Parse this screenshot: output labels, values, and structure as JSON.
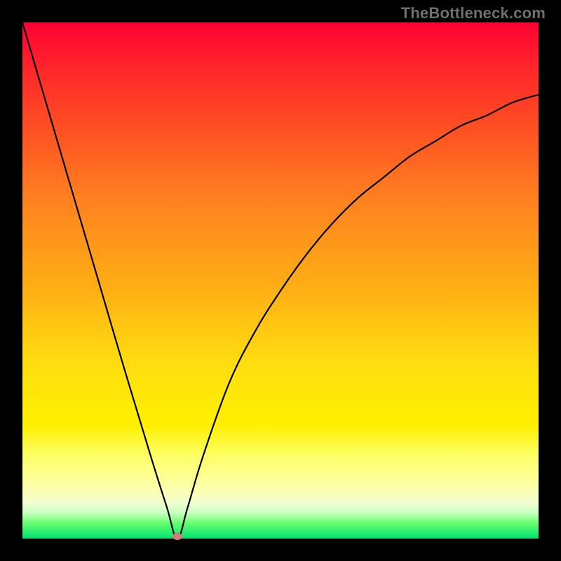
{
  "watermark": "TheBottleneck.com",
  "chart_data": {
    "type": "line",
    "title": "",
    "xlabel": "",
    "ylabel": "",
    "xlim": [
      0,
      1
    ],
    "ylim": [
      0,
      1
    ],
    "grid": false,
    "legend": false,
    "background_gradient": {
      "direction": "vertical",
      "stops": [
        {
          "pos": 0.0,
          "color": "#ff0033"
        },
        {
          "pos": 0.22,
          "color": "#ff5522"
        },
        {
          "pos": 0.52,
          "color": "#ffb015"
        },
        {
          "pos": 0.78,
          "color": "#fff000"
        },
        {
          "pos": 0.93,
          "color": "#f2ffd0"
        },
        {
          "pos": 1.0,
          "color": "#00e070"
        }
      ]
    },
    "min_point": {
      "x": 0.3,
      "y": 0.0
    },
    "series": [
      {
        "name": "curve",
        "x": [
          0.0,
          0.05,
          0.1,
          0.15,
          0.2,
          0.25,
          0.28,
          0.3,
          0.32,
          0.35,
          0.4,
          0.45,
          0.5,
          0.55,
          0.6,
          0.65,
          0.7,
          0.75,
          0.8,
          0.85,
          0.9,
          0.95,
          1.0
        ],
        "y": [
          1.0,
          0.83,
          0.66,
          0.49,
          0.32,
          0.155,
          0.06,
          0.0,
          0.06,
          0.16,
          0.3,
          0.4,
          0.48,
          0.55,
          0.61,
          0.66,
          0.7,
          0.74,
          0.77,
          0.8,
          0.82,
          0.845,
          0.86
        ]
      }
    ]
  }
}
